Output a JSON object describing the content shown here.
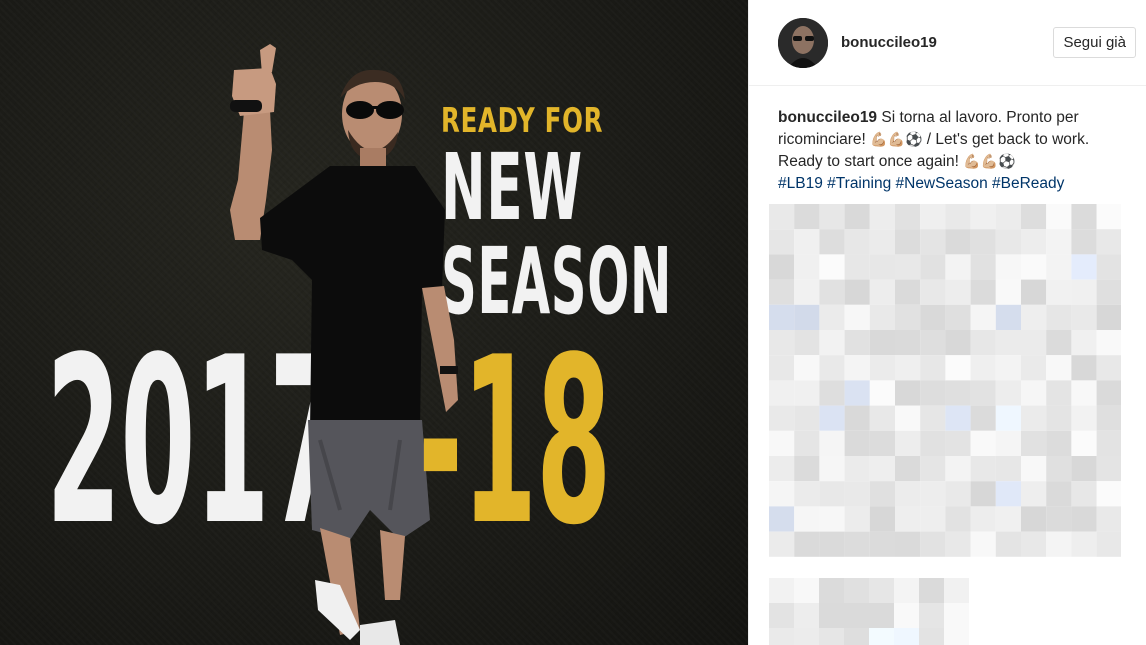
{
  "post_image": {
    "headline_small": "READY FOR",
    "headline_line1": "NEW",
    "headline_line2": "SEASON",
    "year_start": "2017",
    "year_end": "-18",
    "accent_color": "#e2b52a",
    "background_color": "#1b1b17"
  },
  "header": {
    "username": "bonucci­leo19",
    "follow_button_label": "Segui già"
  },
  "caption": {
    "username": "bonucci­leo19",
    "text_it": "Si torna al lavoro. Pronto per ricominciare!",
    "emoji_1": "💪🏼💪🏼⚽",
    "text_en": "/ Let's get back to work. Ready to start once again!",
    "emoji_2": "💪🏼💪🏼⚽",
    "hashtags": [
      "#LB19",
      "#Training",
      "#NewSeason",
      "#BeReady"
    ]
  },
  "icons": {
    "avatar": "avatar-image",
    "pixelated_comments": "blurred-comments"
  }
}
